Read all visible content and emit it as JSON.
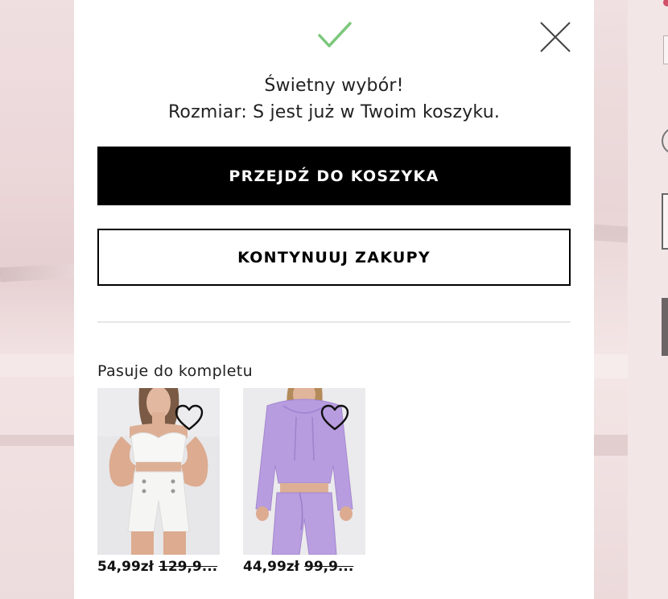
{
  "dialog": {
    "title": "Świetny wybór!",
    "message": "Rozmiar: S jest już w Twoim koszyku.",
    "primary_button": "PRZEJDŹ DO KOSZYKA",
    "secondary_button": "KONTYNUUJ ZAKUPY",
    "close_icon": "close-icon",
    "success_icon": "checkmark-icon"
  },
  "recommendations": {
    "title": "Pasuje do kompletu",
    "items": [
      {
        "price": "54,99zł",
        "old_price": "129,9...",
        "image": "white-set-photo",
        "icon": "heart-icon"
      },
      {
        "price": "44,99zł",
        "old_price": "99,9...",
        "image": "lilac-set-photo",
        "icon": "heart-icon"
      }
    ]
  },
  "colors": {
    "check": "#7cc77c",
    "primary_bg": "#000000",
    "backdrop": "#f1dfe0"
  }
}
